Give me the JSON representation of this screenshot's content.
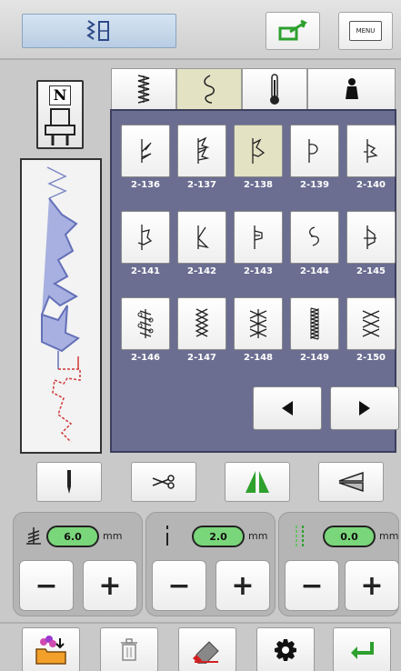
{
  "header": {
    "mode_icon": "utility-stitch-mode-icon",
    "buttons": [
      {
        "name": "external-device-button",
        "icon": "green-arrow-icon"
      },
      {
        "name": "menu-button",
        "label": "MENU"
      }
    ]
  },
  "left": {
    "presser_foot_letter": "N"
  },
  "tabs": [
    {
      "name": "tab-overlock",
      "icon": "zigzag-stitch-icon",
      "active": false
    },
    {
      "name": "tab-decorative",
      "icon": "leaf-stitch-icon",
      "active": true
    },
    {
      "name": "tab-heirloom",
      "icon": "thermometer-stitch-icon",
      "active": false
    },
    {
      "name": "tab-special",
      "icon": "bell-icon",
      "active": false
    }
  ],
  "stitches": [
    {
      "code": "2-136",
      "icon": "stitch-136-icon",
      "selected": false
    },
    {
      "code": "2-137",
      "icon": "stitch-137-icon",
      "selected": false
    },
    {
      "code": "2-138",
      "icon": "stitch-138-icon",
      "selected": true
    },
    {
      "code": "2-139",
      "icon": "stitch-139-icon",
      "selected": false
    },
    {
      "code": "2-140",
      "icon": "stitch-140-icon",
      "selected": false
    },
    {
      "code": "2-141",
      "icon": "stitch-141-icon",
      "selected": false
    },
    {
      "code": "2-142",
      "icon": "stitch-142-icon",
      "selected": false
    },
    {
      "code": "2-143",
      "icon": "stitch-143-icon",
      "selected": false
    },
    {
      "code": "2-144",
      "icon": "stitch-144-icon",
      "selected": false
    },
    {
      "code": "2-145",
      "icon": "stitch-145-icon",
      "selected": false
    },
    {
      "code": "2-146",
      "icon": "stitch-146-icon",
      "selected": false
    },
    {
      "code": "2-147",
      "icon": "stitch-147-icon",
      "selected": false
    },
    {
      "code": "2-148",
      "icon": "stitch-148-icon",
      "selected": false
    },
    {
      "code": "2-149",
      "icon": "stitch-149-icon",
      "selected": false
    },
    {
      "code": "2-150",
      "icon": "stitch-150-icon",
      "selected": false
    }
  ],
  "pager": {
    "prev_icon": "triangle-left-icon",
    "next_icon": "triangle-right-icon"
  },
  "tools": [
    {
      "name": "needle-position-button",
      "icon": "needle-icon"
    },
    {
      "name": "thread-cutter-button",
      "icon": "scissors-icon"
    },
    {
      "name": "mirror-horizontal-button",
      "icon": "mirror-green-icon"
    },
    {
      "name": "mirror-vertical-button",
      "icon": "mirror-gray-icon"
    }
  ],
  "adjusters": [
    {
      "name": "stitch-width",
      "icon": "width-icon",
      "value": "6.0",
      "unit": "mm",
      "minus": "−",
      "plus": "+"
    },
    {
      "name": "stitch-length",
      "icon": "length-icon",
      "value": "2.0",
      "unit": "mm",
      "minus": "−",
      "plus": "+"
    },
    {
      "name": "needle-position",
      "icon": "position-icon",
      "value": "0.0",
      "unit": "mm",
      "minus": "−",
      "plus": "+"
    }
  ],
  "bottom": [
    {
      "name": "memory-button",
      "icon": "folder-flower-icon"
    },
    {
      "name": "delete-button",
      "icon": "trash-icon"
    },
    {
      "name": "clear-button",
      "icon": "eraser-icon"
    },
    {
      "name": "settings-button",
      "icon": "gear-icon"
    },
    {
      "name": "ok-button",
      "icon": "enter-arrow-icon"
    }
  ],
  "colors": {
    "accent_green": "#2da02d",
    "panel": "#6b6e91",
    "selected": "#e3e3c4",
    "value_pill": "#7ad67a"
  }
}
